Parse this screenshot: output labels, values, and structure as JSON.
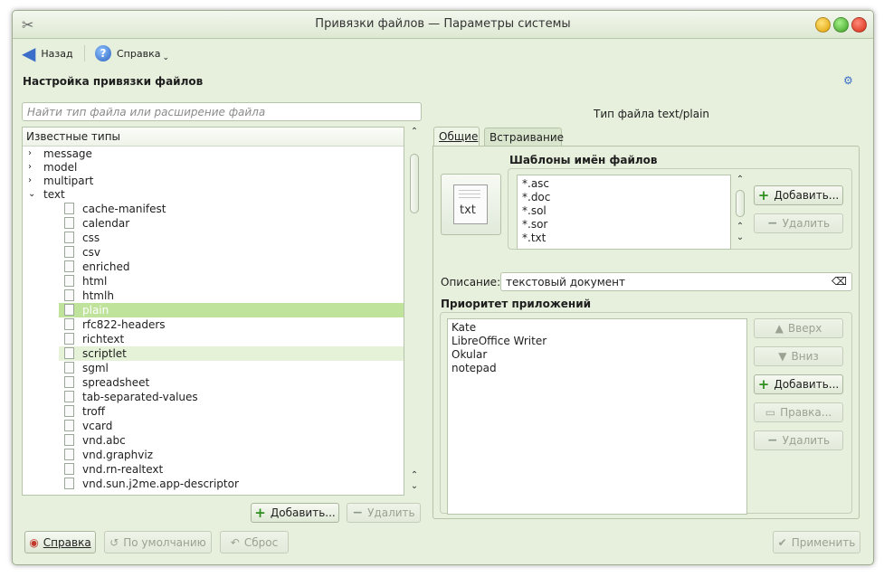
{
  "window": {
    "title": "Привязки файлов — Параметры системы"
  },
  "toolbar": {
    "back_label": "Назад",
    "help_label": "Справка"
  },
  "page": {
    "heading": "Настройка привязки файлов"
  },
  "search": {
    "placeholder": "Найти тип файла или расширение файла",
    "value": ""
  },
  "known_types": {
    "header": "Известные типы",
    "groups": [
      "message",
      "model",
      "multipart",
      "text"
    ],
    "children": [
      "cache-manifest",
      "calendar",
      "css",
      "csv",
      "enriched",
      "html",
      "htmlh",
      "plain",
      "rfc822-headers",
      "richtext",
      "scriptlet",
      "sgml",
      "spreadsheet",
      "tab-separated-values",
      "troff",
      "vcard",
      "vnd.abc",
      "vnd.graphviz",
      "vnd.rn-realtext",
      "vnd.sun.j2me.app-descriptor"
    ],
    "selected": "plain",
    "add_label": "Добавить...",
    "remove_label": "Удалить"
  },
  "details": {
    "filetype_label": "Тип файла text/plain",
    "tabs": [
      "Общие",
      "Встраивание"
    ],
    "icon_text": "txt",
    "patterns_title": "Шаблоны имён файлов",
    "patterns": [
      "*.asc",
      "*.doc",
      "*.sol",
      "*.sor",
      "*.txt"
    ],
    "patterns_add_label": "Добавить...",
    "patterns_remove_label": "Удалить",
    "description_label": "Описание:",
    "description_value": "текстовый документ",
    "priority_title": "Приоритет приложений",
    "apps": [
      "Kate",
      "LibreOffice Writer",
      "Okular",
      "notepad"
    ],
    "up_label": "Вверх",
    "down_label": "Вниз",
    "apps_add_label": "Добавить...",
    "edit_label": "Правка...",
    "apps_remove_label": "Удалить"
  },
  "footer": {
    "help_label": "Справка",
    "defaults_label": "По умолчанию",
    "reset_label": "Сброс",
    "apply_label": "Применить"
  }
}
